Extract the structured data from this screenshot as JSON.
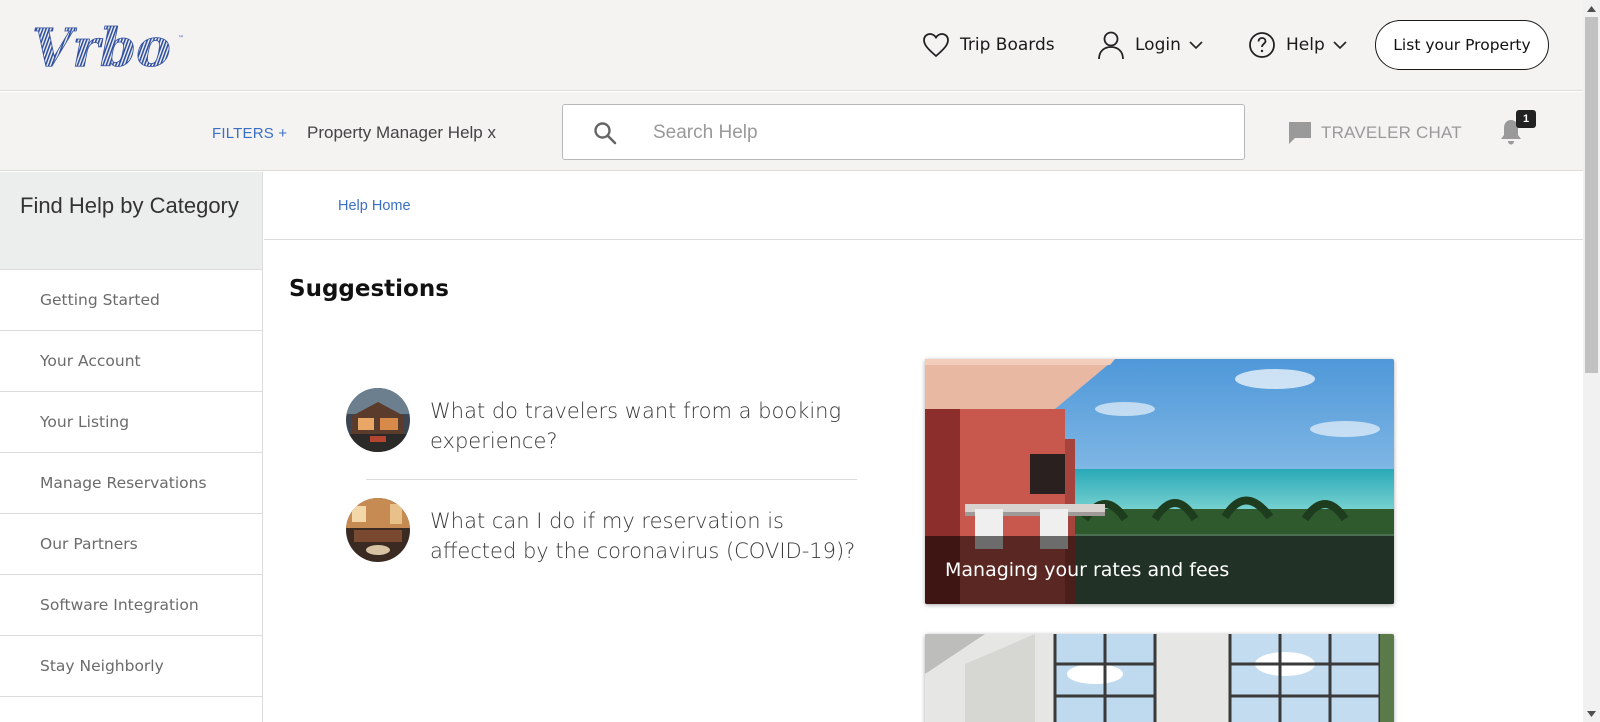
{
  "header": {
    "logo_text": "Vrbo",
    "trip_boards": "Trip Boards",
    "login": "Login",
    "help": "Help",
    "list_property": "List your Property"
  },
  "filterbar": {
    "filters_label": "FILTERS +",
    "active_filter": "Property Manager Help x",
    "search_placeholder": "Search Help",
    "traveler_chat": "TRAVELER CHAT",
    "notification_count": "1"
  },
  "sidebar": {
    "heading": "Find Help by Category",
    "items": [
      {
        "label": "Getting Started"
      },
      {
        "label": "Your Account"
      },
      {
        "label": "Your Listing"
      },
      {
        "label": "Manage Reservations"
      },
      {
        "label": "Our Partners"
      },
      {
        "label": "Software Integration"
      },
      {
        "label": "Stay Neighborly"
      }
    ]
  },
  "main": {
    "breadcrumb": "Help Home",
    "suggestions_title": "Suggestions",
    "suggestions": [
      {
        "text": "What do travelers want from a booking experience?"
      },
      {
        "text": "What can I do if my reservation is affected by the coronavirus (COVID-19)?"
      }
    ],
    "cards": [
      {
        "caption": "Managing your rates and fees"
      },
      {
        "caption": ""
      }
    ]
  },
  "colors": {
    "brand_blue": "#2f4fa0",
    "link_blue": "#3b6fc4",
    "header_bg": "#f4f3f2"
  }
}
